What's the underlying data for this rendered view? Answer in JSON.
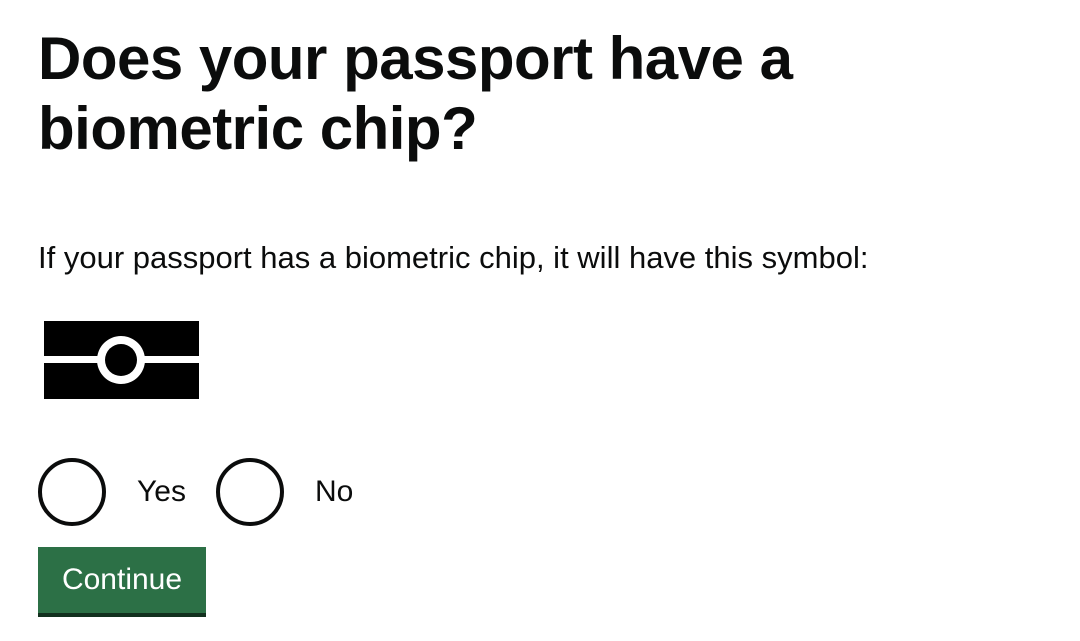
{
  "question": {
    "heading": "Does your passport have a biometric chip?",
    "hint": "If your passport has a biometric chip, it will have this symbol:"
  },
  "symbol": {
    "icon": "biometric-chip-icon"
  },
  "options": [
    {
      "label": "Yes",
      "selected": false
    },
    {
      "label": "No",
      "selected": false
    }
  ],
  "actions": {
    "continue_label": "Continue"
  },
  "colors": {
    "text": "#0b0c0c",
    "button": "#2c7046",
    "button_shadow": "#12301e"
  }
}
